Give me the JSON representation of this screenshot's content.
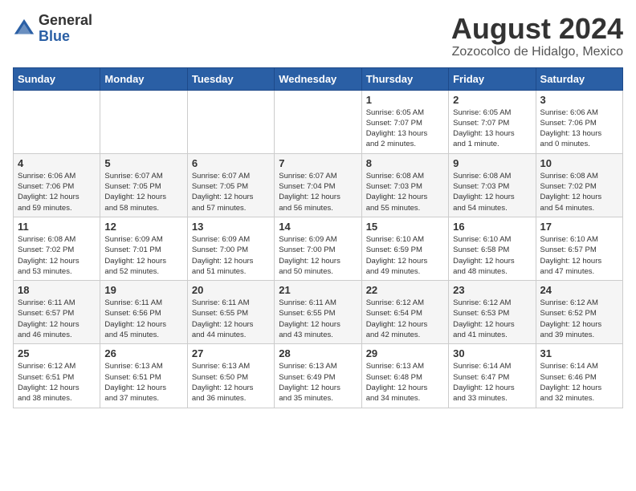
{
  "header": {
    "logo_line1": "General",
    "logo_line2": "Blue",
    "title": "August 2024",
    "subtitle": "Zozocolco de Hidalgo, Mexico"
  },
  "weekdays": [
    "Sunday",
    "Monday",
    "Tuesday",
    "Wednesday",
    "Thursday",
    "Friday",
    "Saturday"
  ],
  "weeks": [
    [
      {
        "day": "",
        "info": ""
      },
      {
        "day": "",
        "info": ""
      },
      {
        "day": "",
        "info": ""
      },
      {
        "day": "",
        "info": ""
      },
      {
        "day": "1",
        "info": "Sunrise: 6:05 AM\nSunset: 7:07 PM\nDaylight: 13 hours\nand 2 minutes."
      },
      {
        "day": "2",
        "info": "Sunrise: 6:05 AM\nSunset: 7:07 PM\nDaylight: 13 hours\nand 1 minute."
      },
      {
        "day": "3",
        "info": "Sunrise: 6:06 AM\nSunset: 7:06 PM\nDaylight: 13 hours\nand 0 minutes."
      }
    ],
    [
      {
        "day": "4",
        "info": "Sunrise: 6:06 AM\nSunset: 7:06 PM\nDaylight: 12 hours\nand 59 minutes."
      },
      {
        "day": "5",
        "info": "Sunrise: 6:07 AM\nSunset: 7:05 PM\nDaylight: 12 hours\nand 58 minutes."
      },
      {
        "day": "6",
        "info": "Sunrise: 6:07 AM\nSunset: 7:05 PM\nDaylight: 12 hours\nand 57 minutes."
      },
      {
        "day": "7",
        "info": "Sunrise: 6:07 AM\nSunset: 7:04 PM\nDaylight: 12 hours\nand 56 minutes."
      },
      {
        "day": "8",
        "info": "Sunrise: 6:08 AM\nSunset: 7:03 PM\nDaylight: 12 hours\nand 55 minutes."
      },
      {
        "day": "9",
        "info": "Sunrise: 6:08 AM\nSunset: 7:03 PM\nDaylight: 12 hours\nand 54 minutes."
      },
      {
        "day": "10",
        "info": "Sunrise: 6:08 AM\nSunset: 7:02 PM\nDaylight: 12 hours\nand 54 minutes."
      }
    ],
    [
      {
        "day": "11",
        "info": "Sunrise: 6:08 AM\nSunset: 7:02 PM\nDaylight: 12 hours\nand 53 minutes."
      },
      {
        "day": "12",
        "info": "Sunrise: 6:09 AM\nSunset: 7:01 PM\nDaylight: 12 hours\nand 52 minutes."
      },
      {
        "day": "13",
        "info": "Sunrise: 6:09 AM\nSunset: 7:00 PM\nDaylight: 12 hours\nand 51 minutes."
      },
      {
        "day": "14",
        "info": "Sunrise: 6:09 AM\nSunset: 7:00 PM\nDaylight: 12 hours\nand 50 minutes."
      },
      {
        "day": "15",
        "info": "Sunrise: 6:10 AM\nSunset: 6:59 PM\nDaylight: 12 hours\nand 49 minutes."
      },
      {
        "day": "16",
        "info": "Sunrise: 6:10 AM\nSunset: 6:58 PM\nDaylight: 12 hours\nand 48 minutes."
      },
      {
        "day": "17",
        "info": "Sunrise: 6:10 AM\nSunset: 6:57 PM\nDaylight: 12 hours\nand 47 minutes."
      }
    ],
    [
      {
        "day": "18",
        "info": "Sunrise: 6:11 AM\nSunset: 6:57 PM\nDaylight: 12 hours\nand 46 minutes."
      },
      {
        "day": "19",
        "info": "Sunrise: 6:11 AM\nSunset: 6:56 PM\nDaylight: 12 hours\nand 45 minutes."
      },
      {
        "day": "20",
        "info": "Sunrise: 6:11 AM\nSunset: 6:55 PM\nDaylight: 12 hours\nand 44 minutes."
      },
      {
        "day": "21",
        "info": "Sunrise: 6:11 AM\nSunset: 6:55 PM\nDaylight: 12 hours\nand 43 minutes."
      },
      {
        "day": "22",
        "info": "Sunrise: 6:12 AM\nSunset: 6:54 PM\nDaylight: 12 hours\nand 42 minutes."
      },
      {
        "day": "23",
        "info": "Sunrise: 6:12 AM\nSunset: 6:53 PM\nDaylight: 12 hours\nand 41 minutes."
      },
      {
        "day": "24",
        "info": "Sunrise: 6:12 AM\nSunset: 6:52 PM\nDaylight: 12 hours\nand 39 minutes."
      }
    ],
    [
      {
        "day": "25",
        "info": "Sunrise: 6:12 AM\nSunset: 6:51 PM\nDaylight: 12 hours\nand 38 minutes."
      },
      {
        "day": "26",
        "info": "Sunrise: 6:13 AM\nSunset: 6:51 PM\nDaylight: 12 hours\nand 37 minutes."
      },
      {
        "day": "27",
        "info": "Sunrise: 6:13 AM\nSunset: 6:50 PM\nDaylight: 12 hours\nand 36 minutes."
      },
      {
        "day": "28",
        "info": "Sunrise: 6:13 AM\nSunset: 6:49 PM\nDaylight: 12 hours\nand 35 minutes."
      },
      {
        "day": "29",
        "info": "Sunrise: 6:13 AM\nSunset: 6:48 PM\nDaylight: 12 hours\nand 34 minutes."
      },
      {
        "day": "30",
        "info": "Sunrise: 6:14 AM\nSunset: 6:47 PM\nDaylight: 12 hours\nand 33 minutes."
      },
      {
        "day": "31",
        "info": "Sunrise: 6:14 AM\nSunset: 6:46 PM\nDaylight: 12 hours\nand 32 minutes."
      }
    ]
  ]
}
